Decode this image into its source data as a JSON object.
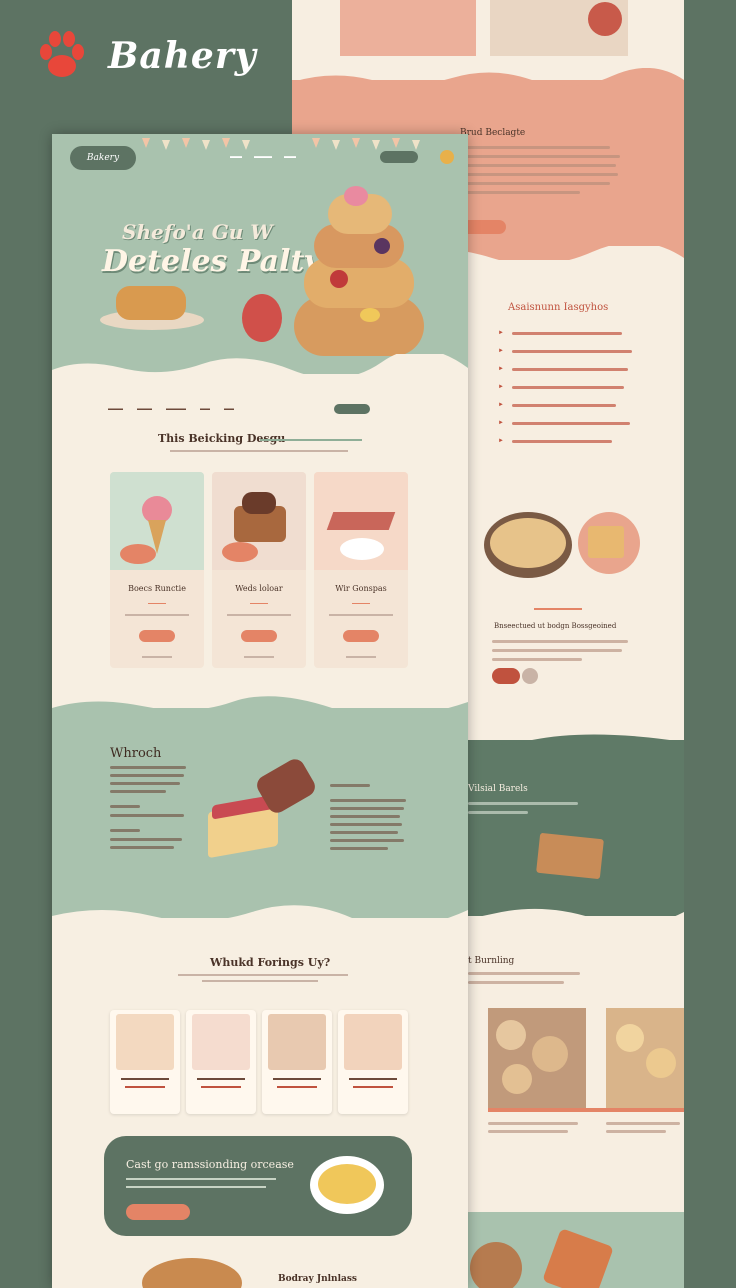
{
  "brand": {
    "name": "Bahery",
    "icon": "paw-icon",
    "color": "#e8473a"
  },
  "colors": {
    "sage": "#a9c2ae",
    "dark": "#5d7363",
    "peach": "#e9a58d",
    "cream": "#f7efe2",
    "accent": "#e48466"
  },
  "front": {
    "logo": "Bakery",
    "hero": {
      "line1": "Shefo'a Gu W",
      "line2": "Deteles Paltve!"
    },
    "section1": {
      "title": "This Beicking Desgu"
    },
    "cards": [
      {
        "title": "Boecs Runctie"
      },
      {
        "title": "Weds loloar"
      },
      {
        "title": "Wir Gonspas"
      }
    ],
    "about": {
      "title": "Whroch"
    },
    "section2": {
      "title": "Whukd Forings Uy?"
    },
    "cta": {
      "title": "Cast go ramssionding orcease"
    },
    "footer": {
      "title": "Bodray Jnlnlass"
    }
  },
  "back": {
    "section_top": {
      "title": "Brud Beclagte"
    },
    "list": {
      "title": "Asaisnunn Iasgyhos"
    },
    "feature": {
      "title": "Bnseectued ut bodgn Bossgeoined"
    },
    "sage_section": {
      "title": "Vilsial Barels"
    },
    "products": {
      "title": "t Burnling"
    }
  }
}
